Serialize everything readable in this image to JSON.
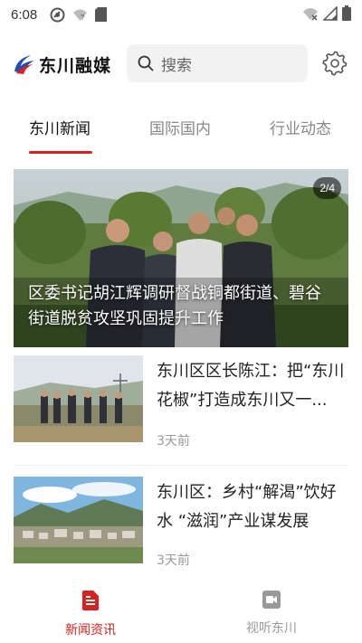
{
  "status_bar": {
    "time": "6:08"
  },
  "header": {
    "logo_text": "东川融媒",
    "search_placeholder": "搜索"
  },
  "tabs": [
    {
      "label": "东川新闻",
      "active": true
    },
    {
      "label": "国际国内",
      "active": false
    },
    {
      "label": "行业动态",
      "active": false
    }
  ],
  "hero": {
    "badge": "2/4",
    "caption": "区委书记胡江辉调研督战铜都街道、碧谷街道脱贫攻坚巩固提升工作"
  },
  "news": [
    {
      "title": "东川区区长陈江：把“东川花椒”打造成东川又一...",
      "time": "3天前"
    },
    {
      "title": "东川区：乡村“解渴”饮好水 “滋润”产业谋发展",
      "time": "3天前"
    }
  ],
  "bottom_nav": [
    {
      "label": "新闻资讯",
      "icon": "news-icon",
      "active": true
    },
    {
      "label": "视听东川",
      "icon": "video-icon",
      "active": false
    }
  ],
  "colors": {
    "accent": "#d8221f",
    "logo_blue": "#1f4fb4"
  }
}
